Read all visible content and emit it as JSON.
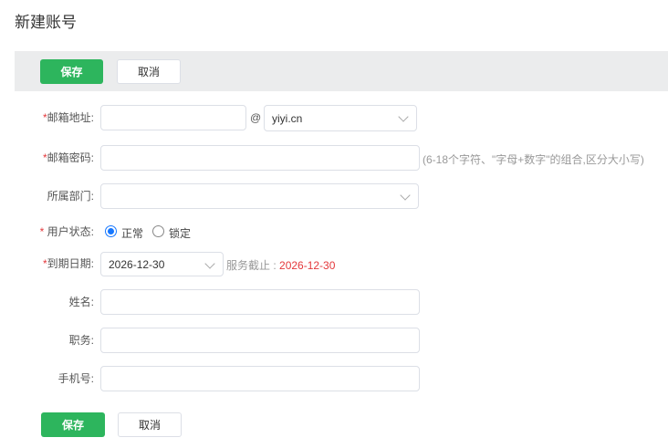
{
  "page_title": "新建账号",
  "toolbar": {
    "save": "保存",
    "cancel": "取消"
  },
  "form": {
    "email": {
      "label": "邮箱地址:",
      "value": "",
      "at": "@",
      "domain": "yiyi.cn"
    },
    "password": {
      "label": "邮箱密码:",
      "value": "",
      "hint": "(6-18个字符、\"字母+数字\"的组合,区分大小写)"
    },
    "department": {
      "label": "所属部门:",
      "value": ""
    },
    "status": {
      "label": "用户状态:",
      "options": [
        "正常",
        "锁定"
      ],
      "selected": "正常"
    },
    "expiry": {
      "label": "到期日期:",
      "value": "2026-12-30",
      "service_label": "服务截止 : ",
      "service_date": "2026-12-30"
    },
    "name": {
      "label": "姓名:",
      "value": ""
    },
    "position": {
      "label": "职务:",
      "value": ""
    },
    "phone": {
      "label": "手机号:",
      "value": ""
    },
    "required_mark": "*"
  },
  "colors": {
    "primary": "#2db55d",
    "required": "#e4393c",
    "radio": "#1677ff"
  }
}
